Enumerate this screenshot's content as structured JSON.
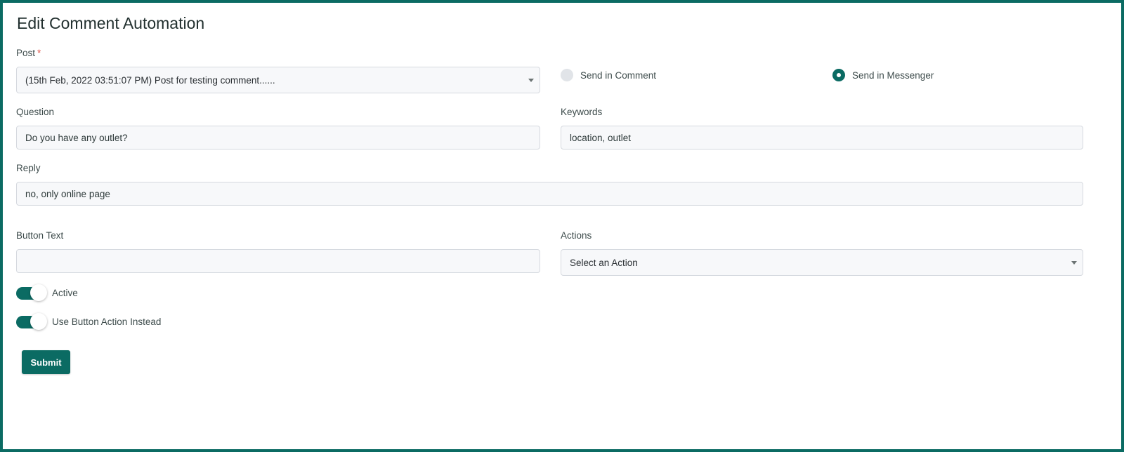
{
  "page": {
    "title": "Edit Comment Automation"
  },
  "form": {
    "post": {
      "label": "Post",
      "required_mark": "*",
      "selected": "(15th Feb, 2022 03:51:07 PM) Post for testing comment......"
    },
    "send_options": [
      {
        "label": "Send in Comment",
        "selected": false
      },
      {
        "label": "Send in Messenger",
        "selected": true
      }
    ],
    "question": {
      "label": "Question",
      "value": "Do you have any outlet?"
    },
    "keywords": {
      "label": "Keywords",
      "value": "location, outlet"
    },
    "reply": {
      "label": "Reply",
      "value": "no, only online page"
    },
    "button_text": {
      "label": "Button Text",
      "value": ""
    },
    "actions": {
      "label": "Actions",
      "selected": "Select an Action"
    },
    "toggles": [
      {
        "label": "Active",
        "on": true
      },
      {
        "label": "Use Button Action Instead",
        "on": true
      }
    ],
    "submit_label": "Submit"
  },
  "colors": {
    "accent": "#0b6b63",
    "border": "#0b6b63",
    "required": "#e0554a",
    "input_bg": "#f7f8fa"
  }
}
